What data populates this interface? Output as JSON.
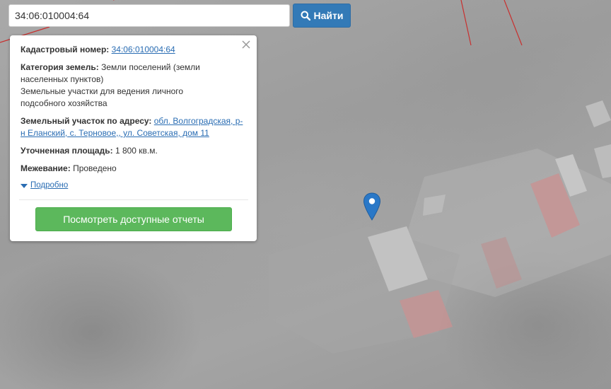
{
  "search": {
    "value": "34:06:010004:64",
    "button_label": "Найти",
    "button_icon": "search-icon"
  },
  "info_card": {
    "cadastral_number": {
      "label": "Кадастровый номер:",
      "value": "34:06:010004:64"
    },
    "land_category": {
      "label": "Категория земель:",
      "value": "Земли поселений (земли населенных пунктов)",
      "use_type": "Земельные участки для ведения личного подсобного хозяйства"
    },
    "address": {
      "label": "Земельный участок по адресу:",
      "value": "обл. Волгоградская, р-н Еланский, с. Терновое,, ул. Советская, дом 11"
    },
    "area": {
      "label": "Уточненная площадь:",
      "value": "1 800 кв.м."
    },
    "survey": {
      "label": "Межевание:",
      "value": "Проведено"
    },
    "details_link": "Подробно",
    "reports_button": "Посмотреть доступные отчеты",
    "close_icon": "close-icon"
  },
  "map": {
    "marker_icon": "map-pin-icon",
    "colors": {
      "marker": "#2a78c7",
      "boundary_lines": "#c8302f",
      "roof_red": "#c98a8a"
    }
  },
  "colors": {
    "search_button": "#337ab7",
    "reports_button": "#5cb85c",
    "link": "#2a6db3"
  }
}
